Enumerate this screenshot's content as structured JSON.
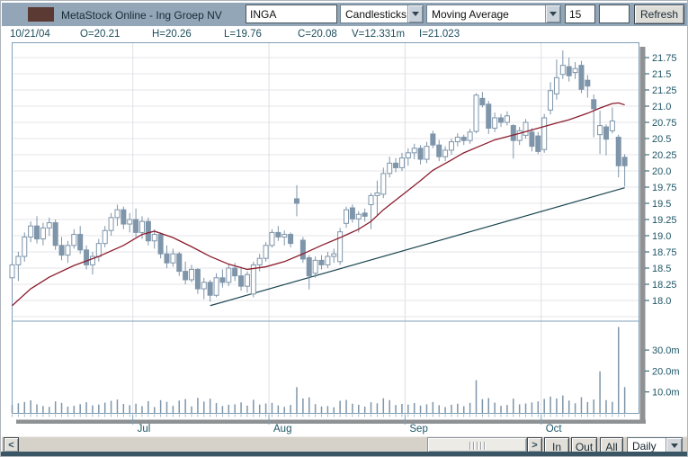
{
  "titlebar": {
    "title": "MetaStock Online - Ing Groep NV",
    "symbol_input": "INGA",
    "chart_type": "Candlesticks",
    "indicator": "Moving Average",
    "indicator_period": "15",
    "extra_input": "",
    "refresh_label": "Refresh"
  },
  "info_bar": {
    "date": "10/21/04",
    "open": "O=20.21",
    "high": "H=20.26",
    "low": "L=19.76",
    "close": "C=20.08",
    "volume": "V=12.331m",
    "indicator_value": "I=21.023"
  },
  "bottom_bar": {
    "scroll_left": "<",
    "scroll_right": ">",
    "zoom_in": "In",
    "zoom_out": "Out",
    "zoom_all": "All",
    "period": "Daily"
  },
  "chart_data": {
    "type": "candlestick+volume",
    "symbol": "INGA",
    "price_axis": {
      "ticks": [
        21.75,
        21.5,
        21.25,
        21.0,
        20.75,
        20.5,
        20.25,
        20.0,
        19.75,
        19.5,
        19.25,
        19.0,
        18.75,
        18.5,
        18.25,
        18.0
      ],
      "grid_step": 0.25
    },
    "volume_axis": {
      "ticks_m": [
        30,
        20,
        10
      ],
      "suffix": ".0m",
      "max_m": 43
    },
    "months": [
      {
        "label": "Jul",
        "start_index": 20
      },
      {
        "label": "Aug",
        "start_index": 42
      },
      {
        "label": "Sep",
        "start_index": 64
      },
      {
        "label": "Oct",
        "start_index": 86
      }
    ],
    "bars": [
      [
        18.35,
        18.62,
        18.05,
        18.55,
        3.8
      ],
      [
        18.55,
        18.75,
        18.3,
        18.68,
        4.6
      ],
      [
        18.68,
        19.05,
        18.6,
        18.98,
        5.2
      ],
      [
        18.98,
        19.22,
        18.9,
        19.15,
        6.0
      ],
      [
        19.15,
        19.3,
        18.88,
        18.95,
        4.1
      ],
      [
        18.95,
        19.2,
        18.85,
        19.12,
        3.3
      ],
      [
        19.12,
        19.28,
        19.0,
        19.2,
        2.9
      ],
      [
        19.2,
        19.25,
        18.78,
        18.85,
        5.5
      ],
      [
        18.85,
        18.98,
        18.62,
        18.7,
        4.8
      ],
      [
        18.7,
        18.92,
        18.58,
        18.85,
        3.0
      ],
      [
        18.85,
        19.1,
        18.8,
        19.02,
        3.4
      ],
      [
        19.02,
        19.15,
        18.72,
        18.78,
        4.2
      ],
      [
        18.78,
        18.85,
        18.48,
        18.55,
        5.1
      ],
      [
        18.55,
        18.75,
        18.4,
        18.68,
        3.6
      ],
      [
        18.68,
        18.95,
        18.6,
        18.88,
        4.0
      ],
      [
        18.88,
        19.15,
        18.82,
        19.08,
        4.9
      ],
      [
        19.08,
        19.35,
        19.0,
        19.28,
        5.8
      ],
      [
        19.28,
        19.48,
        19.15,
        19.4,
        6.4
      ],
      [
        19.4,
        19.45,
        19.1,
        19.18,
        4.3
      ],
      [
        19.18,
        19.35,
        19.05,
        19.25,
        3.7
      ],
      [
        19.25,
        19.42,
        18.98,
        19.05,
        4.4
      ],
      [
        19.05,
        19.3,
        18.95,
        19.22,
        3.2
      ],
      [
        19.22,
        19.28,
        18.85,
        18.92,
        5.6
      ],
      [
        18.92,
        19.1,
        18.8,
        19.02,
        2.8
      ],
      [
        19.02,
        19.05,
        18.65,
        18.72,
        6.1
      ],
      [
        18.72,
        18.85,
        18.5,
        18.58,
        5.3
      ],
      [
        18.58,
        18.8,
        18.52,
        18.72,
        3.4
      ],
      [
        18.72,
        18.75,
        18.38,
        18.45,
        5.9
      ],
      [
        18.45,
        18.6,
        18.25,
        18.32,
        6.6
      ],
      [
        18.32,
        18.55,
        18.28,
        18.48,
        3.1
      ],
      [
        18.48,
        18.5,
        18.1,
        18.18,
        7.2
      ],
      [
        18.18,
        18.35,
        18.02,
        18.28,
        5.4
      ],
      [
        18.28,
        18.32,
        17.98,
        18.08,
        6.8
      ],
      [
        18.08,
        18.42,
        18.05,
        18.35,
        4.7
      ],
      [
        18.35,
        18.48,
        18.2,
        18.28,
        3.3
      ],
      [
        18.28,
        18.55,
        18.22,
        18.5,
        3.9
      ],
      [
        18.5,
        18.58,
        18.3,
        18.38,
        4.1
      ],
      [
        18.38,
        18.52,
        18.15,
        18.22,
        5.0
      ],
      [
        18.22,
        18.45,
        18.12,
        18.4,
        3.5
      ],
      [
        18.1,
        18.6,
        18.05,
        18.55,
        6.3
      ],
      [
        18.55,
        18.72,
        18.45,
        18.65,
        4.0
      ],
      [
        18.65,
        18.9,
        18.6,
        18.85,
        4.5
      ],
      [
        18.85,
        19.1,
        18.82,
        19.05,
        4.8
      ],
      [
        19.05,
        19.15,
        18.92,
        18.98,
        3.6
      ],
      [
        18.98,
        19.08,
        18.85,
        19.02,
        2.9
      ],
      [
        19.02,
        19.05,
        18.82,
        18.88,
        3.8
      ],
      [
        19.57,
        19.78,
        19.3,
        19.5,
        12.3
      ],
      [
        18.93,
        18.98,
        18.58,
        18.64,
        6.9
      ],
      [
        18.66,
        18.7,
        18.17,
        18.38,
        7.4
      ],
      [
        18.42,
        18.68,
        18.35,
        18.62,
        4.2
      ],
      [
        18.62,
        18.7,
        18.48,
        18.55,
        3.1
      ],
      [
        18.55,
        18.75,
        18.5,
        18.68,
        3.3
      ],
      [
        18.68,
        18.8,
        18.58,
        18.72,
        2.7
      ],
      [
        18.6,
        19.12,
        18.55,
        19.06,
        5.8
      ],
      [
        19.19,
        19.45,
        19.12,
        19.4,
        6.2
      ],
      [
        19.43,
        19.48,
        19.2,
        19.26,
        4.4
      ],
      [
        19.26,
        19.38,
        19.05,
        19.33,
        3.9
      ],
      [
        19.35,
        19.42,
        19.22,
        19.3,
        3.0
      ],
      [
        19.48,
        19.66,
        19.1,
        19.62,
        5.1
      ],
      [
        19.62,
        19.85,
        19.3,
        19.66,
        4.6
      ],
      [
        19.64,
        20.05,
        19.58,
        19.96,
        7.0
      ],
      [
        19.96,
        20.22,
        19.9,
        20.12,
        6.1
      ],
      [
        20.12,
        20.2,
        19.98,
        20.05,
        3.8
      ],
      [
        20.05,
        20.28,
        20.0,
        20.2,
        4.3
      ],
      [
        20.2,
        20.35,
        20.08,
        20.28,
        4.0
      ],
      [
        20.28,
        20.42,
        20.18,
        20.35,
        4.7
      ],
      [
        20.35,
        20.4,
        20.1,
        20.18,
        3.5
      ],
      [
        20.18,
        20.45,
        20.12,
        20.38,
        4.1
      ],
      [
        20.57,
        20.62,
        20.35,
        20.4,
        5.2
      ],
      [
        20.4,
        20.48,
        20.15,
        20.22,
        3.7
      ],
      [
        20.22,
        20.38,
        20.15,
        20.32,
        2.8
      ],
      [
        20.32,
        20.5,
        20.25,
        20.45,
        3.9
      ],
      [
        20.45,
        20.58,
        20.38,
        20.52,
        4.4
      ],
      [
        20.52,
        20.56,
        20.4,
        20.47,
        3.2
      ],
      [
        20.47,
        20.65,
        20.42,
        20.6,
        4.8
      ],
      [
        20.61,
        21.2,
        20.58,
        21.17,
        15.6
      ],
      [
        21.12,
        21.22,
        20.98,
        21.02,
        6.6
      ],
      [
        21.03,
        21.08,
        20.57,
        20.66,
        7.1
      ],
      [
        20.66,
        20.9,
        20.6,
        20.82,
        4.9
      ],
      [
        20.82,
        20.88,
        20.68,
        20.75,
        3.4
      ],
      [
        20.75,
        20.92,
        20.7,
        20.85,
        3.8
      ],
      [
        20.7,
        20.72,
        20.19,
        20.47,
        6.8
      ],
      [
        20.47,
        20.68,
        20.4,
        20.62,
        4.1
      ],
      [
        20.55,
        20.8,
        20.5,
        20.75,
        4.5
      ],
      [
        20.6,
        20.66,
        20.3,
        20.38,
        5.0
      ],
      [
        20.54,
        20.6,
        20.26,
        20.3,
        5.5
      ],
      [
        20.33,
        20.88,
        20.28,
        20.82,
        6.7
      ],
      [
        20.94,
        21.37,
        20.87,
        21.24,
        7.8
      ],
      [
        21.19,
        21.72,
        21.1,
        21.44,
        6.9
      ],
      [
        21.49,
        21.86,
        21.42,
        21.63,
        8.3
      ],
      [
        21.61,
        21.75,
        21.38,
        21.47,
        5.9
      ],
      [
        21.52,
        21.68,
        21.42,
        21.58,
        4.6
      ],
      [
        21.63,
        21.7,
        21.2,
        21.26,
        7.5
      ],
      [
        21.4,
        21.48,
        21.13,
        21.31,
        5.2
      ],
      [
        21.1,
        21.18,
        20.52,
        20.96,
        6.4
      ],
      [
        20.56,
        20.93,
        20.26,
        20.7,
        19.8
      ],
      [
        20.68,
        20.72,
        20.24,
        20.49,
        6.1
      ],
      [
        20.62,
        20.98,
        20.58,
        20.77,
        5.3
      ],
      [
        20.52,
        20.56,
        19.9,
        20.08,
        41.0
      ],
      [
        20.21,
        20.26,
        19.76,
        20.08,
        12.331
      ]
    ],
    "ma15": {
      "period": 15,
      "points": [
        [
          0,
          17.92
        ],
        [
          3,
          18.18
        ],
        [
          6,
          18.36
        ],
        [
          10,
          18.54
        ],
        [
          14,
          18.68
        ],
        [
          18,
          18.85
        ],
        [
          21,
          19.02
        ],
        [
          23,
          19.07
        ],
        [
          26,
          18.97
        ],
        [
          29,
          18.83
        ],
        [
          32,
          18.68
        ],
        [
          35,
          18.56
        ],
        [
          38,
          18.48
        ],
        [
          41,
          18.52
        ],
        [
          44,
          18.6
        ],
        [
          47,
          18.72
        ],
        [
          50,
          18.85
        ],
        [
          53,
          18.97
        ],
        [
          56,
          19.1
        ],
        [
          58,
          19.22
        ],
        [
          60,
          19.4
        ],
        [
          62,
          19.55
        ],
        [
          64,
          19.7
        ],
        [
          66,
          19.85
        ],
        [
          68,
          20.01
        ],
        [
          71,
          20.17
        ],
        [
          73,
          20.28
        ],
        [
          76,
          20.4
        ],
        [
          78,
          20.48
        ],
        [
          80,
          20.53
        ],
        [
          82,
          20.58
        ],
        [
          85,
          20.66
        ],
        [
          88,
          20.74
        ],
        [
          90,
          20.79
        ],
        [
          93,
          20.89
        ],
        [
          95,
          20.97
        ],
        [
          97,
          21.04
        ],
        [
          98,
          21.05
        ],
        [
          99,
          21.02
        ]
      ]
    },
    "trendline": {
      "from_index": 32,
      "from_price": 17.92,
      "to_index": 99,
      "to_price": 19.74
    },
    "colors": {
      "candle": "#7E95AA",
      "candle_up_fill": "#FFFFFF",
      "ma": "#8B1C2C",
      "trendline": "#1A4550",
      "grid": "#E4E4EA",
      "month_grid": "#DFDFE6",
      "frame": "#7FA0B8",
      "axis_text": "#1D5566",
      "shadow": "#8E9294",
      "volume_bar": "#7E95AA"
    }
  }
}
